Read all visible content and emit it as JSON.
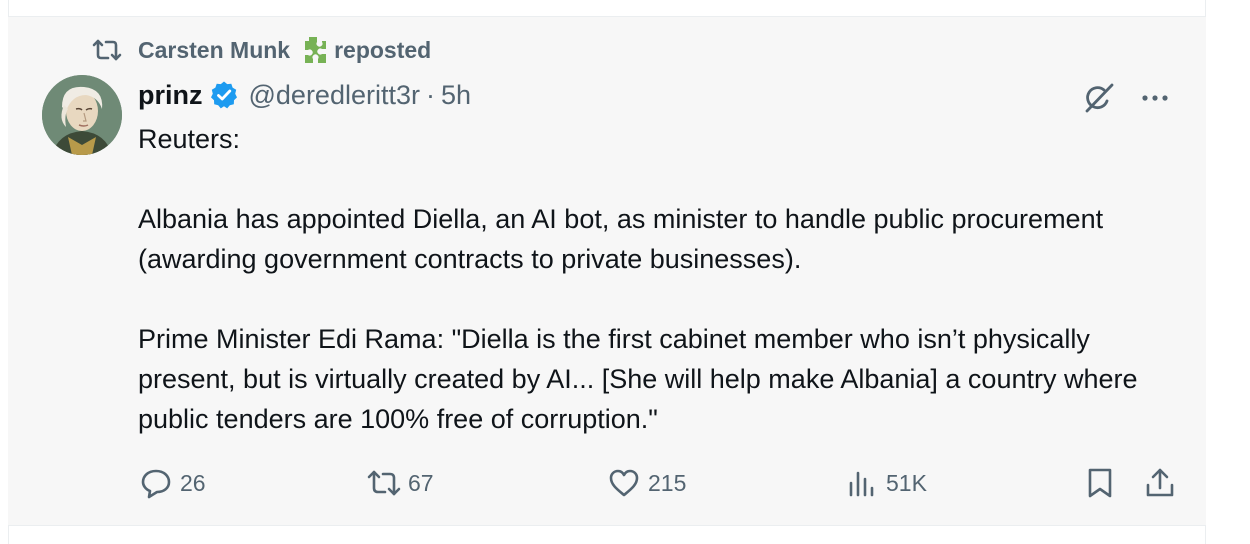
{
  "social_context": {
    "reposter_name": "Carsten Munk",
    "label": "reposted"
  },
  "tweet": {
    "author_name": "prinz",
    "handle": "@deredleritt3r",
    "separator": "·",
    "time": "5h",
    "body": {
      "line1": "Reuters:",
      "para1": "Albania has appointed Diella, an AI bot, as minister to handle public procurement (awarding government contracts to private businesses).",
      "para2": "Prime Minister Edi Rama: \"Diella is the first cabinet member who isn’t physically present, but is virtually created by AI... [She will help make Albania] a country where public tenders are 100% free of corruption.\""
    },
    "stats": {
      "replies": "26",
      "reposts": "67",
      "likes": "215",
      "views": "51K"
    }
  },
  "colors": {
    "secondary_text": "#536471",
    "verified_blue": "#1d9bf0",
    "card_background": "#f7f7f7",
    "puzzle_green": "#77b255"
  },
  "icons": {
    "repost": "repost-icon",
    "puzzle": "puzzle-emoji-icon",
    "verified": "verified-badge-icon",
    "grok": "grok-icon",
    "more": "more-options-icon",
    "reply": "reply-icon",
    "like": "heart-icon",
    "views": "views-icon",
    "bookmark": "bookmark-icon",
    "share": "share-icon"
  }
}
